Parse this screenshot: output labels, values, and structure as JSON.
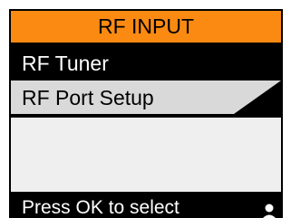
{
  "header": {
    "title": "RF INPUT",
    "accent_color": "#fb8a12"
  },
  "menu": {
    "items": [
      {
        "label": "RF Tuner",
        "state": "highlighted"
      },
      {
        "label": "RF Port Setup",
        "state": "normal"
      }
    ]
  },
  "status": {
    "hint": "Press OK to select",
    "icon": "person-icon"
  }
}
